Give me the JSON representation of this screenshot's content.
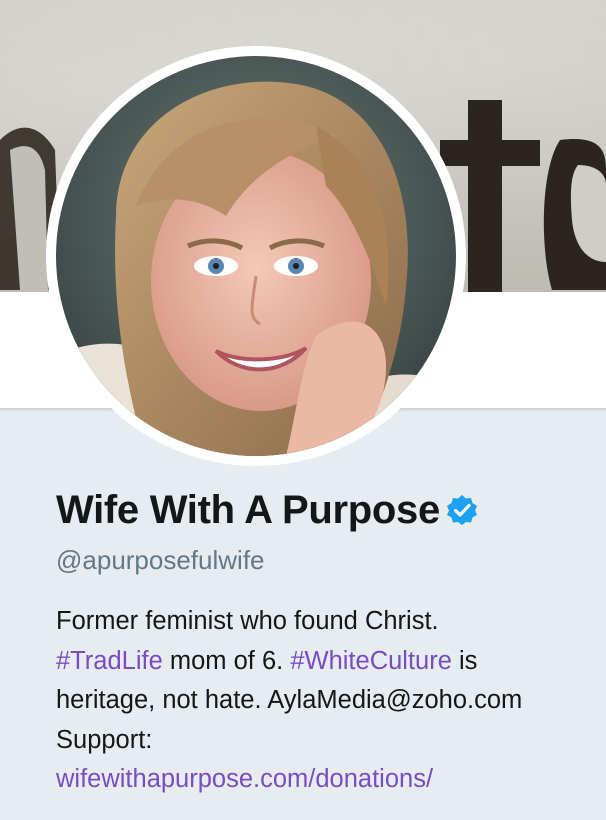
{
  "profile": {
    "display_name": "Wife With A Purpose",
    "verified_icon": "verified-badge-icon",
    "handle": "@apurposefulwife",
    "bio": {
      "line1": "Former feminist who found Christ.",
      "hashtag1": "#TradLife",
      "text1": " mom of 6. ",
      "hashtag2": "#WhiteCulture",
      "text2": " is",
      "line3": "heritage, not hate. AylaMedia@zoho.com",
      "line4": "Support:",
      "url": "wifewithapurpose.com/donations/"
    }
  },
  "colors": {
    "background": "#e6ecf0",
    "name": "#14171a",
    "handle": "#657786",
    "link": "#794bc4",
    "verified": "#1da1f2"
  }
}
